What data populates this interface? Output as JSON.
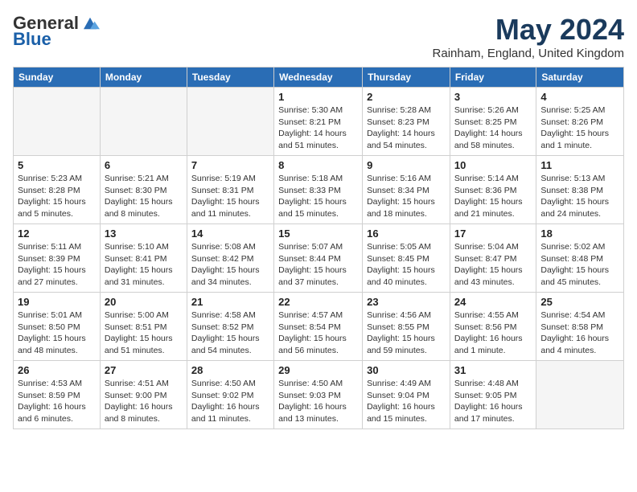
{
  "header": {
    "logo_general": "General",
    "logo_blue": "Blue",
    "month_title": "May 2024",
    "location": "Rainham, England, United Kingdom"
  },
  "weekdays": [
    "Sunday",
    "Monday",
    "Tuesday",
    "Wednesday",
    "Thursday",
    "Friday",
    "Saturday"
  ],
  "weeks": [
    [
      {
        "day": "",
        "info": ""
      },
      {
        "day": "",
        "info": ""
      },
      {
        "day": "",
        "info": ""
      },
      {
        "day": "1",
        "info": "Sunrise: 5:30 AM\nSunset: 8:21 PM\nDaylight: 14 hours\nand 51 minutes."
      },
      {
        "day": "2",
        "info": "Sunrise: 5:28 AM\nSunset: 8:23 PM\nDaylight: 14 hours\nand 54 minutes."
      },
      {
        "day": "3",
        "info": "Sunrise: 5:26 AM\nSunset: 8:25 PM\nDaylight: 14 hours\nand 58 minutes."
      },
      {
        "day": "4",
        "info": "Sunrise: 5:25 AM\nSunset: 8:26 PM\nDaylight: 15 hours\nand 1 minute."
      }
    ],
    [
      {
        "day": "5",
        "info": "Sunrise: 5:23 AM\nSunset: 8:28 PM\nDaylight: 15 hours\nand 5 minutes."
      },
      {
        "day": "6",
        "info": "Sunrise: 5:21 AM\nSunset: 8:30 PM\nDaylight: 15 hours\nand 8 minutes."
      },
      {
        "day": "7",
        "info": "Sunrise: 5:19 AM\nSunset: 8:31 PM\nDaylight: 15 hours\nand 11 minutes."
      },
      {
        "day": "8",
        "info": "Sunrise: 5:18 AM\nSunset: 8:33 PM\nDaylight: 15 hours\nand 15 minutes."
      },
      {
        "day": "9",
        "info": "Sunrise: 5:16 AM\nSunset: 8:34 PM\nDaylight: 15 hours\nand 18 minutes."
      },
      {
        "day": "10",
        "info": "Sunrise: 5:14 AM\nSunset: 8:36 PM\nDaylight: 15 hours\nand 21 minutes."
      },
      {
        "day": "11",
        "info": "Sunrise: 5:13 AM\nSunset: 8:38 PM\nDaylight: 15 hours\nand 24 minutes."
      }
    ],
    [
      {
        "day": "12",
        "info": "Sunrise: 5:11 AM\nSunset: 8:39 PM\nDaylight: 15 hours\nand 27 minutes."
      },
      {
        "day": "13",
        "info": "Sunrise: 5:10 AM\nSunset: 8:41 PM\nDaylight: 15 hours\nand 31 minutes."
      },
      {
        "day": "14",
        "info": "Sunrise: 5:08 AM\nSunset: 8:42 PM\nDaylight: 15 hours\nand 34 minutes."
      },
      {
        "day": "15",
        "info": "Sunrise: 5:07 AM\nSunset: 8:44 PM\nDaylight: 15 hours\nand 37 minutes."
      },
      {
        "day": "16",
        "info": "Sunrise: 5:05 AM\nSunset: 8:45 PM\nDaylight: 15 hours\nand 40 minutes."
      },
      {
        "day": "17",
        "info": "Sunrise: 5:04 AM\nSunset: 8:47 PM\nDaylight: 15 hours\nand 43 minutes."
      },
      {
        "day": "18",
        "info": "Sunrise: 5:02 AM\nSunset: 8:48 PM\nDaylight: 15 hours\nand 45 minutes."
      }
    ],
    [
      {
        "day": "19",
        "info": "Sunrise: 5:01 AM\nSunset: 8:50 PM\nDaylight: 15 hours\nand 48 minutes."
      },
      {
        "day": "20",
        "info": "Sunrise: 5:00 AM\nSunset: 8:51 PM\nDaylight: 15 hours\nand 51 minutes."
      },
      {
        "day": "21",
        "info": "Sunrise: 4:58 AM\nSunset: 8:52 PM\nDaylight: 15 hours\nand 54 minutes."
      },
      {
        "day": "22",
        "info": "Sunrise: 4:57 AM\nSunset: 8:54 PM\nDaylight: 15 hours\nand 56 minutes."
      },
      {
        "day": "23",
        "info": "Sunrise: 4:56 AM\nSunset: 8:55 PM\nDaylight: 15 hours\nand 59 minutes."
      },
      {
        "day": "24",
        "info": "Sunrise: 4:55 AM\nSunset: 8:56 PM\nDaylight: 16 hours\nand 1 minute."
      },
      {
        "day": "25",
        "info": "Sunrise: 4:54 AM\nSunset: 8:58 PM\nDaylight: 16 hours\nand 4 minutes."
      }
    ],
    [
      {
        "day": "26",
        "info": "Sunrise: 4:53 AM\nSunset: 8:59 PM\nDaylight: 16 hours\nand 6 minutes."
      },
      {
        "day": "27",
        "info": "Sunrise: 4:51 AM\nSunset: 9:00 PM\nDaylight: 16 hours\nand 8 minutes."
      },
      {
        "day": "28",
        "info": "Sunrise: 4:50 AM\nSunset: 9:02 PM\nDaylight: 16 hours\nand 11 minutes."
      },
      {
        "day": "29",
        "info": "Sunrise: 4:50 AM\nSunset: 9:03 PM\nDaylight: 16 hours\nand 13 minutes."
      },
      {
        "day": "30",
        "info": "Sunrise: 4:49 AM\nSunset: 9:04 PM\nDaylight: 16 hours\nand 15 minutes."
      },
      {
        "day": "31",
        "info": "Sunrise: 4:48 AM\nSunset: 9:05 PM\nDaylight: 16 hours\nand 17 minutes."
      },
      {
        "day": "",
        "info": ""
      }
    ]
  ]
}
